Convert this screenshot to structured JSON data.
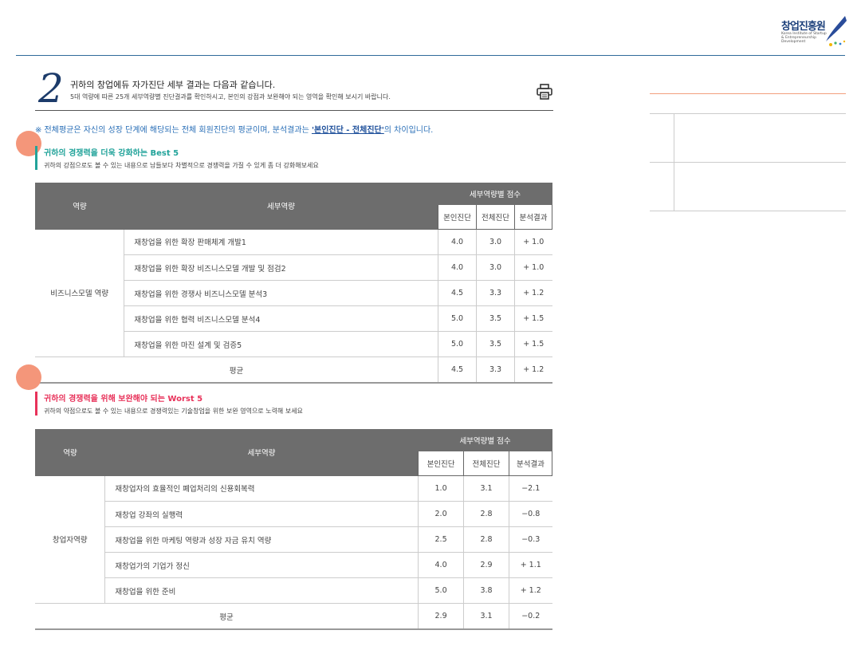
{
  "brand": {
    "name": "창업진흥원",
    "sub": "Korea Institute of Startup & Entrepreneurship Development"
  },
  "section": {
    "number": "2",
    "title": "귀하의 창업에듀 자가진단 세부 결과는 다음과 같습니다.",
    "subtitle": "5대 역량에 따른 25개 세부역량별 진단결과를 확인하시고, 본인의 강점과 보완해야 되는 영역을 확인해 보시기 바랍니다."
  },
  "notice": {
    "prefix": "※ 전체평균은 자신의 성장 단계에 해당되는 전체 회원진단의 평균이며, 분석결과는 ",
    "highlight": "'본인진단 - 전체진단'",
    "suffix": "의 차이입니다."
  },
  "best": {
    "title": "귀하의 경쟁력을 더욱 강화하는 Best 5",
    "subtitle": "귀하의 강점으로도 볼 수 있는 내용으로 남들보다 차별적으로 경쟁력을 가질 수 있게 좀 더 강화해보세요",
    "accent": "#22a39a",
    "headers": {
      "cat": "역량",
      "item": "세부역량",
      "group": "세부역량별 점수",
      "self": "본인진단",
      "all": "전체진단",
      "diff": "분석결과"
    },
    "category": "비즈니스모델 역량",
    "rows": [
      {
        "item": "재창업을 위한 확장 판매체계 개발1",
        "self": "4.0",
        "all": "3.0",
        "diff": "+ 1.0"
      },
      {
        "item": "재창업을 위한 확장 비즈니스모델 개발 및 점검2",
        "self": "4.0",
        "all": "3.0",
        "diff": "+ 1.0"
      },
      {
        "item": "재창업을 위한 경쟁사 비즈니스모델 분석3",
        "self": "4.5",
        "all": "3.3",
        "diff": "+ 1.2"
      },
      {
        "item": "재창업을 위한 협력 비즈니스모델 분석4",
        "self": "5.0",
        "all": "3.5",
        "diff": "+ 1.5"
      },
      {
        "item": "재창업을 위한 마진 설계 및 검증5",
        "self": "5.0",
        "all": "3.5",
        "diff": "+ 1.5"
      }
    ],
    "avg": {
      "label": "평균",
      "self": "4.5",
      "all": "3.3",
      "diff": "+ 1.2"
    }
  },
  "worst": {
    "title": "귀하의 경쟁력을 위해 보완해야 되는 Worst 5",
    "subtitle": "귀하의 약점으로도 볼 수 있는 내용으로 경쟁력있는 기술창업을 위한 보완 영역으로 노력해 보세요",
    "accent": "#e8325a",
    "headers": {
      "cat": "역량",
      "item": "세부역량",
      "group": "세부역량별 점수",
      "self": "본인진단",
      "all": "전체진단",
      "diff": "분석결과"
    },
    "category": "창업자역량",
    "rows": [
      {
        "item": "재창업자의 효율적인 폐업처리의 신용회복력",
        "self": "1.0",
        "all": "3.1",
        "diff": "−2.1"
      },
      {
        "item": "재창업 강좌의 실행력",
        "self": "2.0",
        "all": "2.8",
        "diff": "−0.8"
      },
      {
        "item": "재창업을 위한 마케팅 역량과 성장 자금 유치 역량",
        "self": "2.5",
        "all": "2.8",
        "diff": "−0.3"
      },
      {
        "item": "재창업가의 기업가 정신",
        "self": "4.0",
        "all": "2.9",
        "diff": "+ 1.1"
      },
      {
        "item": "재창업을 위한 준비",
        "self": "5.0",
        "all": "3.8",
        "diff": "+ 1.2"
      }
    ],
    "avg": {
      "label": "평균",
      "self": "2.9",
      "all": "3.1",
      "diff": "−0.2"
    }
  }
}
